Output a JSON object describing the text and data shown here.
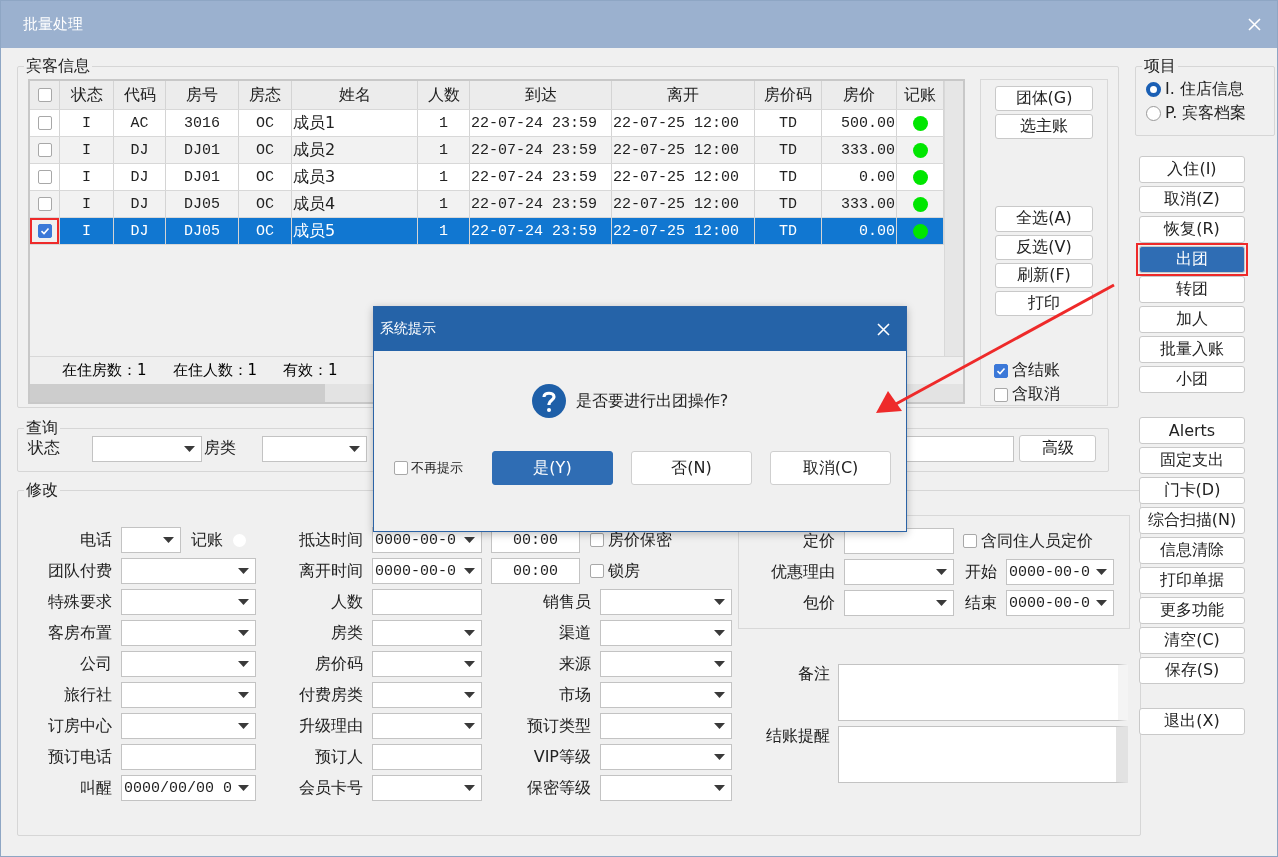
{
  "window": {
    "title": "批量处理"
  },
  "guest_info": {
    "title": "宾客信息",
    "table": {
      "columns": [
        "状态",
        "代码",
        "房号",
        "房态",
        "姓名",
        "人数",
        "到达",
        "离开",
        "房价码",
        "房价",
        "记账"
      ],
      "header_checked": false,
      "rows": [
        {
          "checked": false,
          "highlighted": false,
          "selected": false,
          "cells": [
            "I",
            "AC",
            "3016",
            "OC",
            "成员1",
            "1",
            "22-07-24 23:59",
            "22-07-25 12:00",
            "TD",
            "500.00"
          ],
          "color": "#00e600"
        },
        {
          "checked": false,
          "highlighted": false,
          "selected": false,
          "cells": [
            "I",
            "DJ",
            "DJ01",
            "OC",
            "成员2",
            "1",
            "22-07-24 23:59",
            "22-07-25 12:00",
            "TD",
            "333.00"
          ],
          "color": "#00e600"
        },
        {
          "checked": false,
          "highlighted": false,
          "selected": false,
          "cells": [
            "I",
            "DJ",
            "DJ01",
            "OC",
            "成员3",
            "1",
            "22-07-24 23:59",
            "22-07-25 12:00",
            "TD",
            "0.00"
          ],
          "color": "#00e600"
        },
        {
          "checked": false,
          "highlighted": false,
          "selected": false,
          "cells": [
            "I",
            "DJ",
            "DJ05",
            "OC",
            "成员4",
            "1",
            "22-07-24 23:59",
            "22-07-25 12:00",
            "TD",
            "333.00"
          ],
          "color": "#00e600"
        },
        {
          "checked": true,
          "highlighted": true,
          "selected": true,
          "cells": [
            "I",
            "DJ",
            "DJ05",
            "OC",
            "成员5",
            "1",
            "22-07-24 23:59",
            "22-07-25 12:00",
            "TD",
            "0.00"
          ],
          "color": "#00e600"
        }
      ],
      "footer": [
        "在住房数：1",
        "在住人数：1",
        "有效：1"
      ]
    },
    "buttons_top": [
      "团体(G)",
      "选主账"
    ],
    "buttons_bottom": [
      "全选(A)",
      "反选(V)",
      "刷新(F)",
      "打印"
    ],
    "options": [
      {
        "label": "含结账",
        "checked": true
      },
      {
        "label": "含取消",
        "checked": false
      }
    ]
  },
  "query": {
    "title": "查询",
    "fields": [
      {
        "label": "状态"
      },
      {
        "label": "房类"
      }
    ],
    "button": "高级"
  },
  "modify": {
    "title": "修改",
    "rows": [
      [
        {
          "label": "电话",
          "controls": [
            {
              "kind": "minicombo"
            },
            {
              "kind": "text",
              "text": "记账"
            },
            {
              "kind": "dot"
            }
          ]
        },
        {
          "label": "抵达时间",
          "controls": [
            {
              "kind": "combo",
              "value": "0000-00-0"
            }
          ]
        },
        {
          "controls": [
            {
              "kind": "input",
              "value": "00:00"
            },
            {
              "kind": "check",
              "text": "房价保密",
              "checked": false
            }
          ]
        }
      ],
      [
        {
          "label": "团队付费",
          "controls": [
            {
              "kind": "combo"
            }
          ]
        },
        {
          "label": "离开时间",
          "controls": [
            {
              "kind": "combo",
              "value": "0000-00-0"
            }
          ]
        },
        {
          "controls": [
            {
              "kind": "input",
              "value": "00:00"
            },
            {
              "kind": "check",
              "text": "锁房",
              "checked": false
            }
          ]
        }
      ],
      [
        {
          "label": "特殊要求",
          "controls": [
            {
              "kind": "combo"
            }
          ]
        },
        {
          "label": "人数",
          "controls": [
            {
              "kind": "input"
            }
          ]
        },
        {
          "label": "销售员",
          "controls": [
            {
              "kind": "combo"
            }
          ]
        }
      ],
      [
        {
          "label": "客房布置",
          "controls": [
            {
              "kind": "combo"
            }
          ]
        },
        {
          "label": "房类",
          "controls": [
            {
              "kind": "combo"
            }
          ]
        },
        {
          "label": "渠道",
          "controls": [
            {
              "kind": "combo"
            }
          ]
        }
      ],
      [
        {
          "label": "公司",
          "controls": [
            {
              "kind": "combo"
            }
          ]
        },
        {
          "label": "房价码",
          "controls": [
            {
              "kind": "combo"
            }
          ]
        },
        {
          "label": "来源",
          "controls": [
            {
              "kind": "combo"
            }
          ]
        }
      ],
      [
        {
          "label": "旅行社",
          "controls": [
            {
              "kind": "combo"
            }
          ]
        },
        {
          "label": "付费房类",
          "controls": [
            {
              "kind": "combo"
            }
          ]
        },
        {
          "label": "市场",
          "controls": [
            {
              "kind": "combo"
            }
          ]
        }
      ],
      [
        {
          "label": "订房中心",
          "controls": [
            {
              "kind": "combo"
            }
          ]
        },
        {
          "label": "升级理由",
          "controls": [
            {
              "kind": "combo"
            }
          ]
        },
        {
          "label": "预订类型",
          "controls": [
            {
              "kind": "combo"
            }
          ]
        }
      ],
      [
        {
          "label": "预订电话",
          "controls": [
            {
              "kind": "input"
            }
          ]
        },
        {
          "label": "预订人",
          "controls": [
            {
              "kind": "input"
            }
          ]
        },
        {
          "label": "VIP等级",
          "controls": [
            {
              "kind": "combo"
            }
          ]
        }
      ],
      [
        {
          "label": "叫醒",
          "controls": [
            {
              "kind": "combo",
              "value": "0000/00/00 0"
            }
          ]
        },
        {
          "label": "会员卡号",
          "controls": [
            {
              "kind": "combo"
            }
          ]
        },
        {
          "label": "保密等级",
          "controls": [
            {
              "kind": "combo"
            }
          ]
        }
      ]
    ],
    "pricing": [
      [
        {
          "label": "定价",
          "controls": [
            {
              "kind": "input"
            }
          ]
        },
        {
          "controls": [
            {
              "kind": "check",
              "text": "含同住人员定价",
              "checked": false
            }
          ]
        }
      ],
      [
        {
          "label": "优惠理由",
          "controls": [
            {
              "kind": "combo"
            }
          ]
        },
        {
          "label": "开始",
          "controls": [
            {
              "kind": "combo",
              "value": "0000-00-0"
            }
          ]
        }
      ],
      [
        {
          "label": "包价",
          "controls": [
            {
              "kind": "combo"
            }
          ]
        },
        {
          "label": "结束",
          "controls": [
            {
              "kind": "combo",
              "value": "0000-00-0"
            }
          ]
        }
      ]
    ],
    "notes": [
      {
        "label": "备注"
      },
      {
        "label": "结账提醒"
      }
    ]
  },
  "project": {
    "title": "项目",
    "options": [
      {
        "label": "I. 住店信息",
        "selected": true
      },
      {
        "label": "P. 宾客档案",
        "selected": false
      }
    ]
  },
  "action_groups": [
    [
      {
        "label": "入住(I)",
        "active": false,
        "highlighted": false
      },
      {
        "label": "取消(Z)",
        "active": false,
        "highlighted": false
      },
      {
        "label": "恢复(R)",
        "active": false,
        "highlighted": false
      },
      {
        "label": "出团",
        "active": true,
        "highlighted": true
      },
      {
        "label": "转团",
        "active": false,
        "highlighted": false
      },
      {
        "label": "加人",
        "active": false,
        "highlighted": false
      },
      {
        "label": "批量入账",
        "active": false,
        "highlighted": false
      },
      {
        "label": "小团",
        "active": false,
        "highlighted": false
      }
    ],
    [
      {
        "label": "Alerts",
        "active": false,
        "highlighted": false
      },
      {
        "label": "固定支出",
        "active": false,
        "highlighted": false
      },
      {
        "label": "门卡(D)",
        "active": false,
        "highlighted": false
      },
      {
        "label": "综合扫描(N)",
        "active": false,
        "highlighted": false
      },
      {
        "label": "信息清除",
        "active": false,
        "highlighted": false
      },
      {
        "label": "打印单据",
        "active": false,
        "highlighted": false
      },
      {
        "label": "更多功能",
        "active": false,
        "highlighted": false
      },
      {
        "label": "清空(C)",
        "active": false,
        "highlighted": false
      },
      {
        "label": "保存(S)",
        "active": false,
        "highlighted": false
      }
    ],
    [
      {
        "label": "退出(X)",
        "active": false,
        "highlighted": false
      }
    ]
  ],
  "dialog": {
    "title": "系统提示",
    "message": "是否要进行出团操作?",
    "dont_ask": {
      "label": "不再提示",
      "checked": false
    },
    "buttons": [
      {
        "label": "是(Y)",
        "default": true
      },
      {
        "label": "否(N)",
        "default": false
      },
      {
        "label": "取消(C)",
        "default": false
      }
    ]
  }
}
